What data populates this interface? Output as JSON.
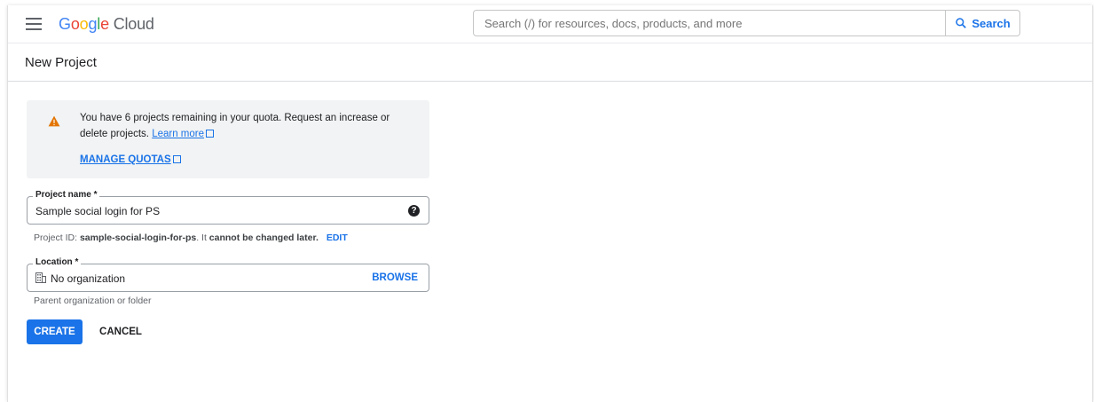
{
  "header": {
    "logo_google": "Google",
    "logo_cloud": "Cloud",
    "search_placeholder": "Search (/) for resources, docs, products, and more",
    "search_button": "Search"
  },
  "page": {
    "title": "New Project"
  },
  "notice": {
    "text": "You have 6 projects remaining in your quota. Request an increase or delete projects.",
    "learn_more": "Learn more",
    "manage_quotas": "MANAGE QUOTAS"
  },
  "project_name": {
    "label": "Project name *",
    "value": "Sample social login for PS",
    "id_prefix": "Project ID:",
    "id_value": "sample-social-login-for-ps",
    "id_suffix": ". It",
    "cannot_change": "cannot be changed later.",
    "edit": "EDIT"
  },
  "location": {
    "label": "Location *",
    "value": "No organization",
    "browse": "BROWSE",
    "hint": "Parent organization or folder"
  },
  "actions": {
    "create": "CREATE",
    "cancel": "CANCEL"
  },
  "colors": {
    "accent": "#1a73e8",
    "warning": "#e37400"
  }
}
